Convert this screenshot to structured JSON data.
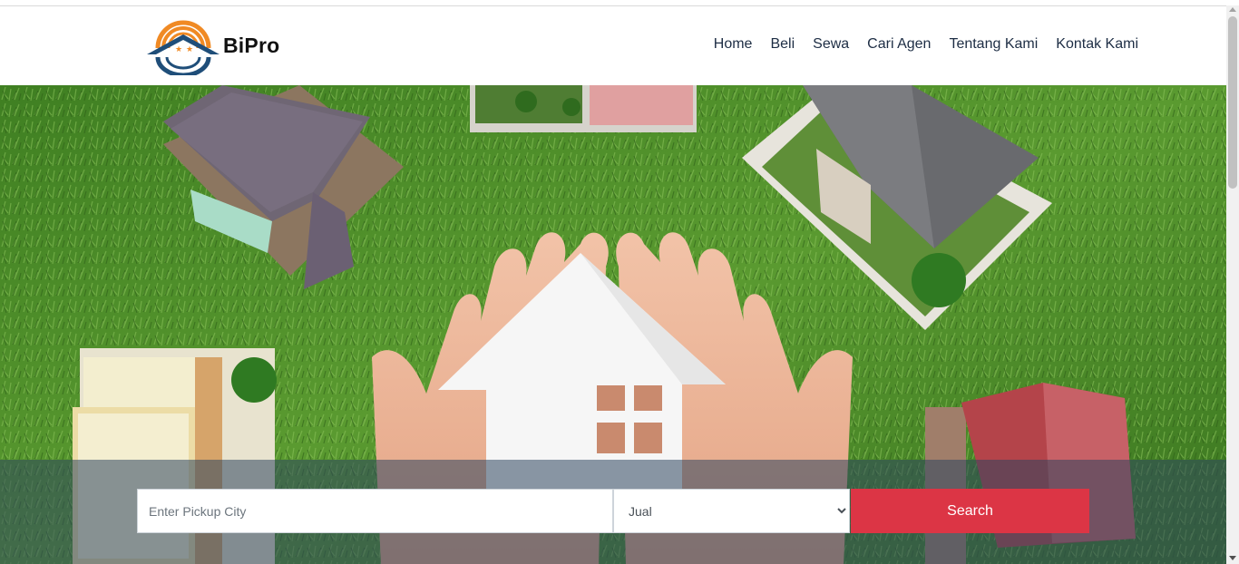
{
  "brand": {
    "name": "BiPro",
    "logo_icon": "sun-house-logo",
    "colors": {
      "orange": "#f08a24",
      "navy": "#1f4e79"
    }
  },
  "nav": {
    "items": [
      {
        "label": "Home"
      },
      {
        "label": "Beli"
      },
      {
        "label": "Sewa"
      },
      {
        "label": "Cari Agen"
      },
      {
        "label": "Tentang Kami"
      },
      {
        "label": "Kontak Kami"
      }
    ]
  },
  "hero": {
    "image": "hands-holding-paper-house-on-grass-with-model-houses"
  },
  "search": {
    "city_placeholder": "Enter Pickup City",
    "city_value": "",
    "type_selected": "Jual",
    "button_label": "Search",
    "button_color": "#dc3545"
  }
}
